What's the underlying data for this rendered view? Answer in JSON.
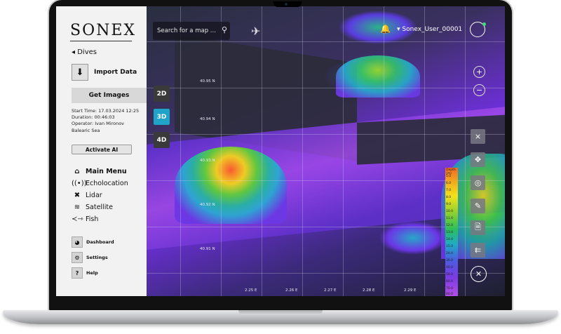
{
  "app": {
    "logo": "SONEX",
    "back_label": "Dives",
    "import_label": "Import Data",
    "get_images_label": "Get Images",
    "info": {
      "start_time": "Start Time: 17.03.2024 12:25",
      "duration": "Duration: 00:46:03",
      "operator": "Operator: Ivan Mironov",
      "location": "Balearic Sea"
    },
    "activate_label": "Activate AI",
    "nav": [
      {
        "label": "Main Menu",
        "icon": "home-icon"
      },
      {
        "label": "Echolocation",
        "icon": "sonar-icon"
      },
      {
        "label": "Lidar",
        "icon": "drone-icon"
      },
      {
        "label": "Satellite",
        "icon": "wifi-icon"
      },
      {
        "label": "Fish",
        "icon": "fish-icon"
      }
    ],
    "sub_nav": [
      {
        "label": "Dashboard",
        "icon": "gauge-icon"
      },
      {
        "label": "Settings",
        "icon": "gear-icon"
      },
      {
        "label": "Help",
        "icon": "question-icon"
      }
    ]
  },
  "topbar": {
    "search_placeholder": "Search for a map ...",
    "username": "Sonex_User_00001"
  },
  "view_modes": [
    "2D",
    "3D",
    "4D"
  ],
  "active_view": "3D",
  "map": {
    "lat_labels": [
      "40.95 N",
      "40.94 N",
      "40.93 N",
      "40.92 N",
      "40.91 N"
    ],
    "lon_labels": [
      "2.25 E",
      "2.26 E",
      "2.27 E",
      "2.28 E",
      "2.29 E"
    ],
    "controls": [
      "zoom-in-icon",
      "zoom-out-icon",
      "collapse-icon",
      "move-icon",
      "locate-icon",
      "ruler-icon",
      "document-icon",
      "share-icon",
      "close-icon"
    ]
  },
  "legend": {
    "unit": "Depth (m)",
    "ticks": [
      "5.0",
      "6.0",
      "7.0",
      "8.0",
      "9.0",
      "10.0",
      "11.0",
      "12.0",
      "13.0",
      "14.0",
      "15.0",
      "20.0",
      "30.0",
      "40.0",
      "50.0",
      "60.0",
      "70.0",
      "80.0"
    ]
  },
  "colors": {
    "accent": "#1fa3c9",
    "sidebar_bg": "#f2f2f2",
    "online_dot": "#3ce07a"
  }
}
